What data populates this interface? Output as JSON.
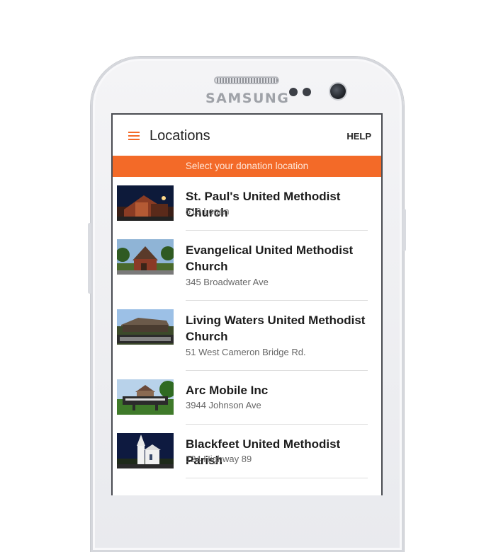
{
  "device": {
    "brand": "SAMSUNG"
  },
  "appbar": {
    "title": "Locations",
    "help_label": "HELP",
    "menu_icon": "hamburger-menu-icon"
  },
  "banner": {
    "text": "Select your donation location"
  },
  "colors": {
    "accent": "#f36a28"
  },
  "locations": [
    {
      "name": "St. Paul's United Methodist Church",
      "address": "519 Logan"
    },
    {
      "name": "Evangelical United Methodist Church",
      "address": "345 Broadwater Ave"
    },
    {
      "name": "Living Waters United Methodist Church",
      "address": "51 West Cameron Bridge Rd."
    },
    {
      "name": "Arc Mobile Inc",
      "address": "3944 Johnson Ave"
    },
    {
      "name": "Blackfeet United Methodist Parish",
      "address": "124 Highway 89"
    }
  ]
}
